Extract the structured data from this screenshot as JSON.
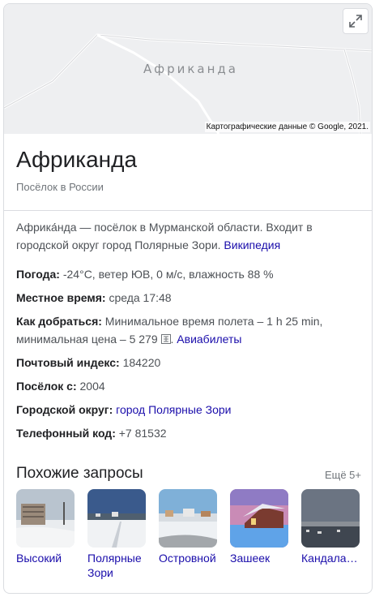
{
  "map": {
    "place_label": "Африканда",
    "credit": "Картографические данные © Google, 2021.",
    "expand_icon": "expand-icon"
  },
  "header": {
    "title": "Африканда",
    "subtitle": "Посёлок в России"
  },
  "description": {
    "text": "Африка́нда — посёлок в Мурманской области. Входит в городской округ город Полярные Зори.",
    "source_link": "Википедия"
  },
  "facts": {
    "weather": {
      "label": "Погода:",
      "value": "-24°C, ветер ЮВ, 0 м/с, влажность 88 %"
    },
    "local_time": {
      "label": "Местное время:",
      "value": "среда 17:48"
    },
    "travel": {
      "label": "Как добраться:",
      "value": "Минимальное время полета – 1 h 25 min, минимальная цена – 5 279",
      "currency_icon": "currency-icon",
      "link": "Авиабилеты"
    },
    "postal": {
      "label": "Почтовый индекс:",
      "value": "184220"
    },
    "settlement_since": {
      "label": "Посёлок с:",
      "value": "2004"
    },
    "district": {
      "label": "Городской округ:",
      "link": "город Полярные Зори"
    },
    "phone": {
      "label": "Телефонный код:",
      "value": "+7 81532"
    }
  },
  "related": {
    "title": "Похожие запросы",
    "more": "Ещё 5+",
    "items": [
      {
        "label": "Высокий"
      },
      {
        "label": "Полярные Зори"
      },
      {
        "label": "Островной"
      },
      {
        "label": "Зашеек"
      },
      {
        "label": "Кандала…"
      }
    ]
  }
}
